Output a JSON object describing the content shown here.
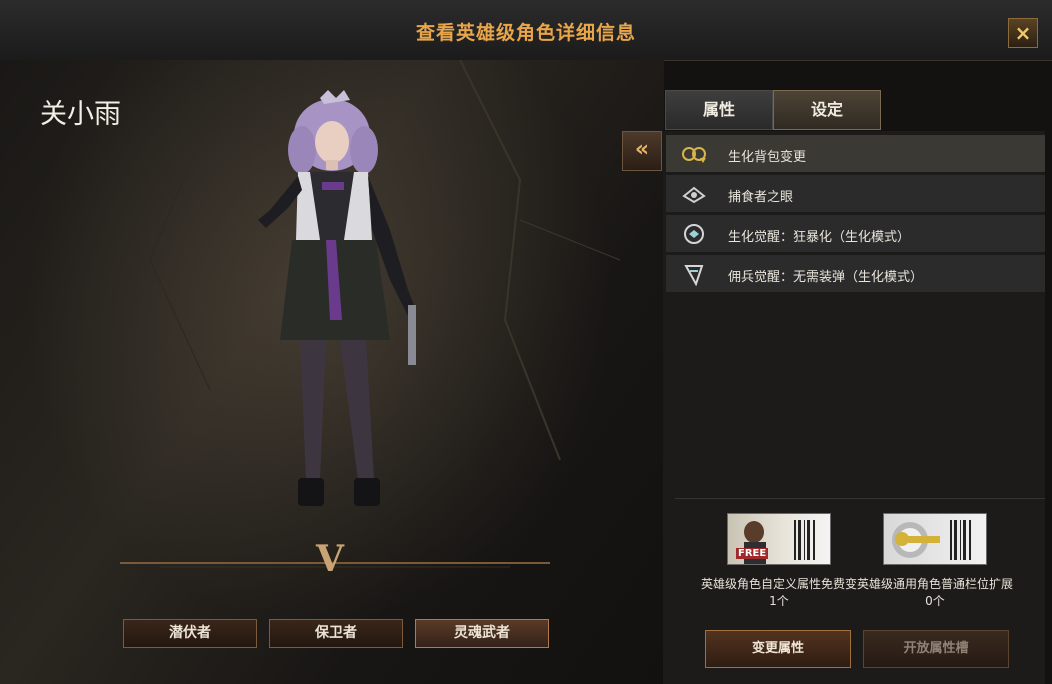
{
  "window": {
    "title": "查看英雄级角色详细信息",
    "close_icon": "×"
  },
  "character": {
    "name": "关小雨",
    "rank_symbol": "V"
  },
  "classes": [
    {
      "label": "潜伏者",
      "active": false
    },
    {
      "label": "保卫者",
      "active": false
    },
    {
      "label": "灵魂武者",
      "active": true
    }
  ],
  "tabs": [
    {
      "label": "属性",
      "active": false
    },
    {
      "label": "设定",
      "active": true
    }
  ],
  "collapse_icon": "«",
  "abilities": [
    {
      "icon": "bio-backpack-icon",
      "label": "生化背包变更",
      "selected": true
    },
    {
      "icon": "predator-eye-icon",
      "label": "捕食者之眼",
      "selected": false
    },
    {
      "icon": "bio-awaken-icon",
      "label": "生化觉醒：狂暴化（生化模式）",
      "selected": false
    },
    {
      "icon": "merc-awaken-icon",
      "label": "佣兵觉醒：无需装弹（生化模式）",
      "selected": false
    }
  ],
  "rewards": [
    {
      "name": "英雄级角色自定义属性免费变",
      "count": "1个",
      "badge": "FREE"
    },
    {
      "name": "英雄级通用角色普通栏位扩展",
      "count": "0个",
      "badge": ""
    }
  ],
  "buttons": {
    "change": "变更属性",
    "open_slot": "开放属性槽"
  },
  "colors": {
    "title": "#e8a54a",
    "accent": "#a0703e"
  }
}
